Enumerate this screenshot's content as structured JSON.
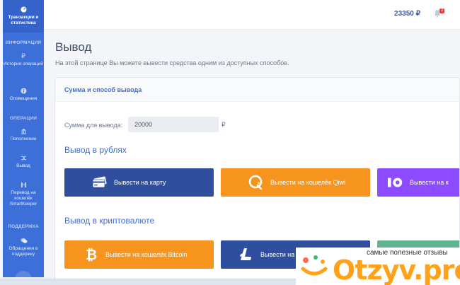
{
  "sidebar": {
    "top_item": {
      "label": "Транзакции и статистика",
      "icon": "dashboard-icon"
    },
    "sections": [
      {
        "title": "ИНФОРМАЦИЯ"
      },
      {
        "title": "ОПЕРАЦИИ"
      },
      {
        "title": "ПОДДЕРЖКА"
      }
    ],
    "items": [
      {
        "label": "История операций",
        "icon": "ruble-icon"
      },
      {
        "label": "Оповещения",
        "icon": "info-icon"
      },
      {
        "label": "Пополнение",
        "icon": "bank-icon"
      },
      {
        "label": "Вывод",
        "icon": "shuffle-icon"
      },
      {
        "label": "Перевод на кошелёк SmartKeeper",
        "icon": "transfer-icon"
      },
      {
        "label": "Обращения в поддержку",
        "icon": "chat-icon"
      }
    ]
  },
  "topbar": {
    "balance": "23350 ₽",
    "notifications_count": "3"
  },
  "page": {
    "title": "Вывод",
    "description": "На этой странице Вы можете вывести средства одним из доступных способов."
  },
  "card": {
    "header": "Сумма и способ вывода",
    "amount_label": "Сумма для вывода:",
    "amount_value": "20000",
    "currency": "₽",
    "rub_title": "Вывод в рублях",
    "crypto_title": "Вывод в криптовалюте",
    "rub_buttons": [
      {
        "label": "Вывести на карту",
        "icon": "card-icon"
      },
      {
        "label": "Вывести на кошелёк Qiwi",
        "icon": "qiwi-icon"
      },
      {
        "label": "Вывести на к",
        "icon": "yoomoney-icon"
      }
    ],
    "crypto_buttons": [
      {
        "label": "Вывести на кошелёк Bitcoin",
        "icon": "bitcoin-icon"
      },
      {
        "label": "Вывести на",
        "icon": "litecoin-icon"
      },
      {
        "label": "",
        "icon": "tether-icon"
      }
    ]
  },
  "watermark": {
    "caption": "самые полезные отзывы",
    "logo": "Otzyv.pro"
  },
  "colors": {
    "sidebar": "#3d6fd8",
    "accent": "#3d6fd8",
    "card_blue": "#2f4f9e",
    "orange": "#f7941d",
    "purple": "#8c4bff",
    "teal": "#5fb38f"
  }
}
